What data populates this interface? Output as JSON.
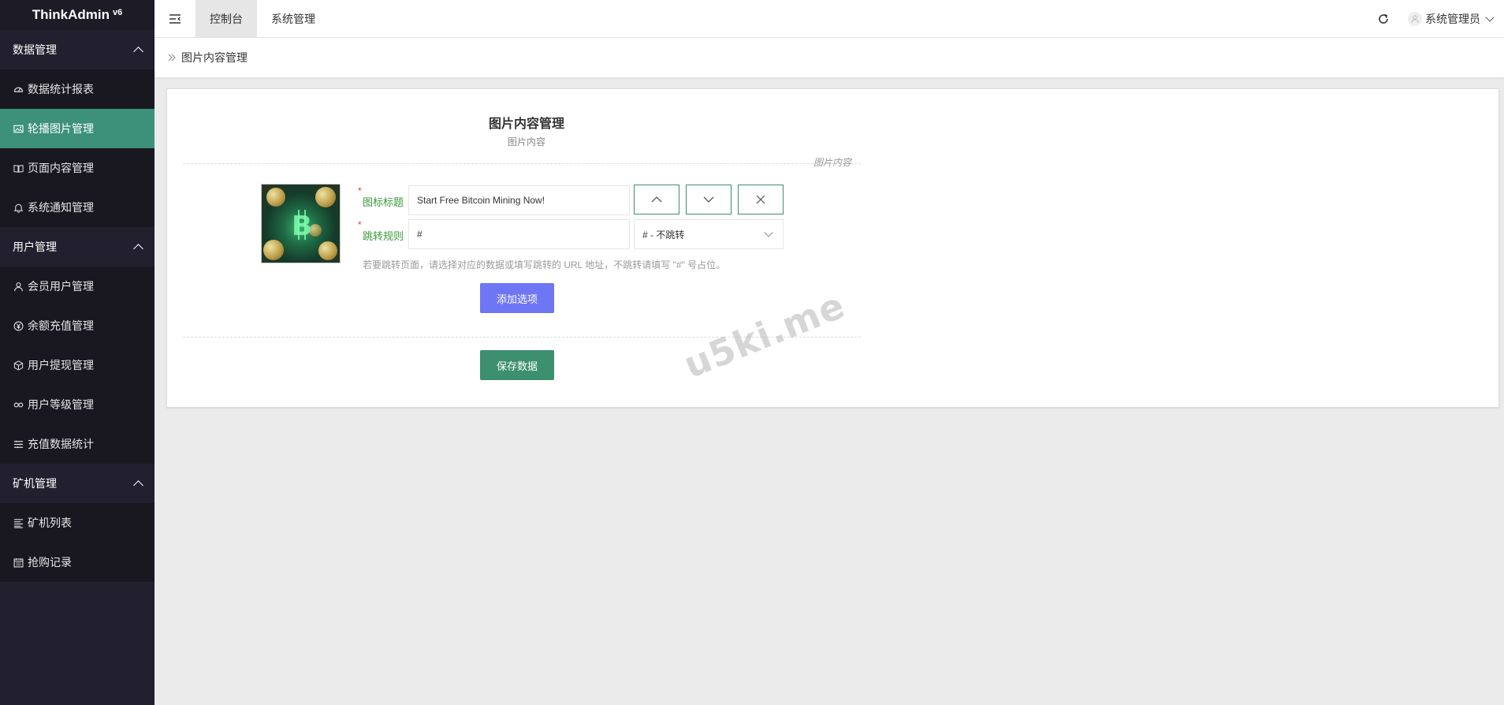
{
  "app": {
    "brand": "ThinkAdmin",
    "version": "v6"
  },
  "topbar": {
    "tabs": [
      {
        "label": "控制台",
        "active": true
      },
      {
        "label": "系统管理",
        "active": false
      }
    ],
    "user": "系统管理员"
  },
  "sidebar": {
    "groups": [
      {
        "title": "数据管理",
        "items": [
          {
            "label": "数据统计报表",
            "icon": "dashboard-icon"
          },
          {
            "label": "轮播图片管理",
            "icon": "image-icon",
            "active": true
          },
          {
            "label": "页面内容管理",
            "icon": "book-icon"
          },
          {
            "label": "系统通知管理",
            "icon": "bell-icon"
          }
        ]
      },
      {
        "title": "用户管理",
        "items": [
          {
            "label": "会员用户管理",
            "icon": "user-icon"
          },
          {
            "label": "余额充值管理",
            "icon": "yen-icon"
          },
          {
            "label": "用户提现管理",
            "icon": "cube-icon"
          },
          {
            "label": "用户等级管理",
            "icon": "link-icon"
          },
          {
            "label": "充值数据统计",
            "icon": "list-icon"
          }
        ]
      },
      {
        "title": "矿机管理",
        "items": [
          {
            "label": "矿机列表",
            "icon": "align-icon"
          },
          {
            "label": "抢购记录",
            "icon": "calendar-icon"
          }
        ]
      }
    ]
  },
  "breadcrumb": "图片内容管理",
  "form": {
    "title": "图片内容管理",
    "subtitle": "图片内容",
    "section_label": "图片内容",
    "title_label": "图标标题",
    "title_value": "Start Free Bitcoin Mining Now!",
    "rule_label": "跳转规则",
    "rule_value": "#",
    "rule_select": "# - 不跳转",
    "help_text": "若要跳转页面，请选择对应的数据或填写跳转的 URL 地址，不跳转请填写 \"#\" 号占位。",
    "add_button": "添加选项",
    "save_button": "保存数据"
  },
  "watermark": "u5ki.me",
  "colors": {
    "sidebar_bg": "#22202e",
    "active_item": "#3c9178",
    "add_button": "#6f76f4",
    "save_button": "#3c8f6f"
  }
}
